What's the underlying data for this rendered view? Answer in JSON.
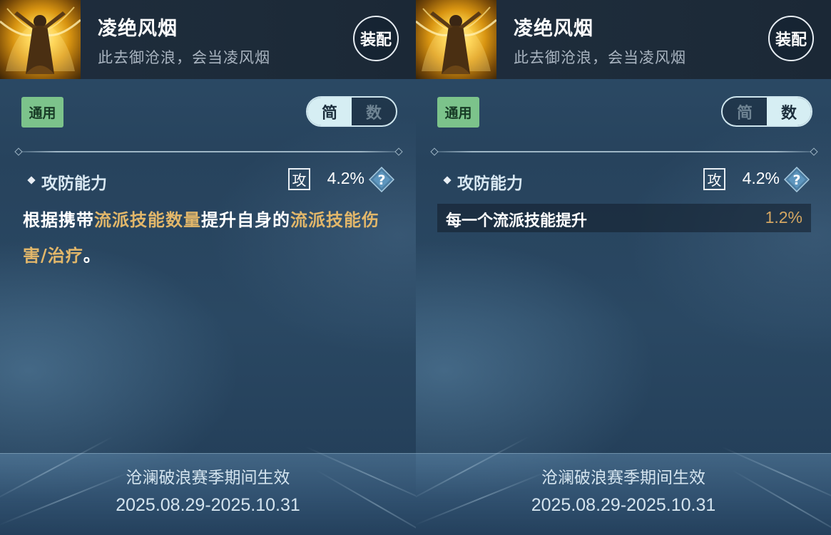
{
  "colors": {
    "accent_gold": "#e2b76a",
    "tag_green": "#7cc38b",
    "toggle_active": "#d6eef3"
  },
  "panels": [
    {
      "mode": "simple",
      "skill": {
        "icon": "monk-golden-aura-icon",
        "title": "凌绝风烟",
        "subtitle": "此去御沧浪，会当凌风烟"
      },
      "equip_label": "装配",
      "tag_label": "通用",
      "toggle": {
        "simple_label": "简",
        "detail_label": "数",
        "active": "simple"
      },
      "stat": {
        "name": "攻防能力",
        "badge": "攻",
        "value": "4.2%"
      },
      "description": {
        "p1": "根据携带",
        "h1": "流派技能数量",
        "p2": "提升自身的",
        "h2": "流派技能伤害/治疗",
        "p3": "。"
      },
      "footer": {
        "line1": "沧澜破浪赛季期间生效",
        "line2": "2025.08.29-2025.10.31"
      }
    },
    {
      "mode": "detail",
      "skill": {
        "icon": "monk-golden-aura-icon",
        "title": "凌绝风烟",
        "subtitle": "此去御沧浪，会当凌风烟"
      },
      "equip_label": "装配",
      "tag_label": "通用",
      "toggle": {
        "simple_label": "简",
        "detail_label": "数",
        "active": "detail"
      },
      "stat": {
        "name": "攻防能力",
        "badge": "攻",
        "value": "4.2%"
      },
      "detail": {
        "label": "每一个流派技能提升",
        "value": "1.2%"
      },
      "footer": {
        "line1": "沧澜破浪赛季期间生效",
        "line2": "2025.08.29-2025.10.31"
      }
    }
  ]
}
